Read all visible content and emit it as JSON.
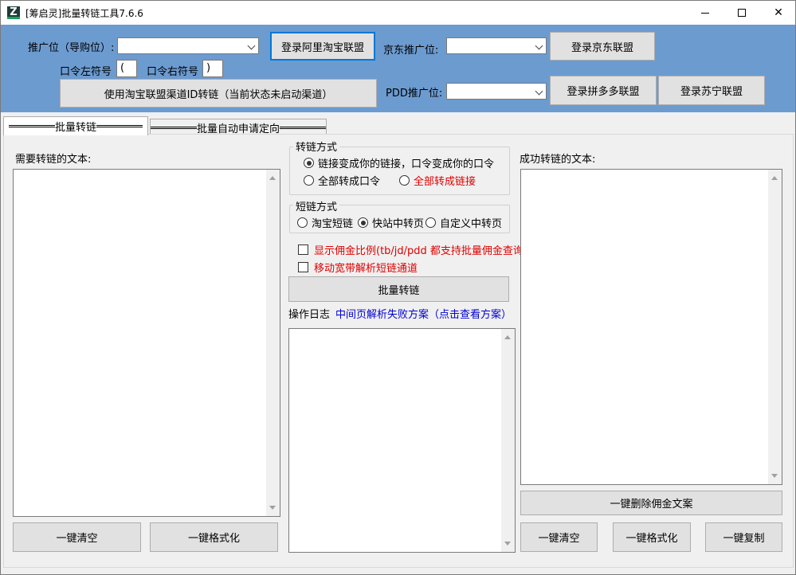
{
  "window": {
    "icon_letter": "Z",
    "title": "[筹启灵]批量转链工具7.6.6"
  },
  "header": {
    "tb_pid_label": "推广位（导购位）:",
    "login_taobao": "登录阿里淘宝联盟",
    "jd_pid_label": "京东推广位:",
    "login_jd": "登录京东联盟",
    "left_symbol_label": "口令左符号",
    "left_symbol_value": "(",
    "right_symbol_label": "口令右符号",
    "right_symbol_value": ")",
    "channel_button": "使用淘宝联盟渠道ID转链（当前状态未启动渠道）",
    "pdd_pid_label": "PDD推广位:",
    "login_pdd": "登录拼多多联盟",
    "login_suning": "登录苏宁联盟"
  },
  "tabs": [
    {
      "label": "批量转链"
    },
    {
      "label": "批量自动申请定向"
    }
  ],
  "left": {
    "label": "需要转链的文本:",
    "clear_button": "一键清空",
    "format_button": "一键格式化"
  },
  "middle": {
    "convert_group_title": "转链方式",
    "convert_opt1": "链接变成你的链接，口令变成你的口令",
    "convert_opt2": "全部转成口令",
    "convert_opt3": "全部转成链接",
    "short_group_title": "短链方式",
    "short_opt1": "淘宝短链",
    "short_opt2": "快站中转页",
    "short_opt3": "自定义中转页",
    "check1": "显示佣金比例(tb/jd/pdd 都支持批量佣金查询)",
    "check2": "移动宽带解析短链通道",
    "convert_button": "批量转链",
    "log_label": "操作日志",
    "log_link": "中间页解析失败方案（点击查看方案）"
  },
  "right": {
    "label": "成功转链的文本:",
    "delete_button": "一键删除佣金文案",
    "clear_button": "一键清空",
    "format_button": "一键格式化",
    "copy_button": "一键复制"
  },
  "colors": {
    "header_blue": "#6c9bd0",
    "red_text": "#e00000",
    "link_blue": "#0000d6"
  }
}
